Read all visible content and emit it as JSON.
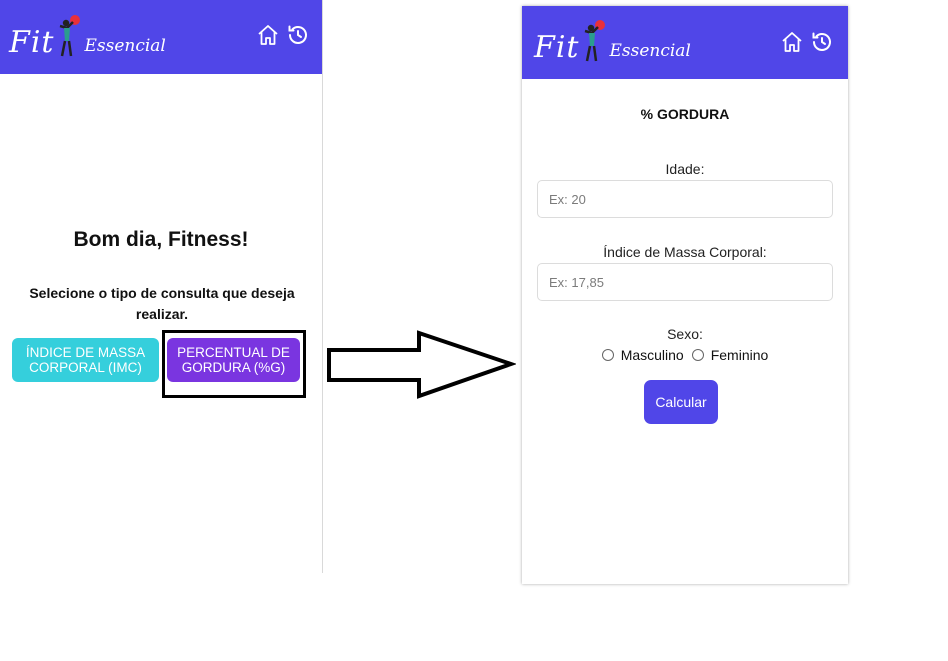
{
  "brand": {
    "logo_fit": "Fit",
    "logo_essencial": "Essencial",
    "color_primary": "#5046e8",
    "color_imc": "#35cfdc",
    "color_gordura": "#7a35e0"
  },
  "header_icons": [
    "home-icon",
    "history-icon"
  ],
  "home_screen": {
    "greeting": "Bom dia, Fitness!",
    "select_prompt": "Selecione o tipo de consulta que deseja realizar.",
    "btn_imc_line1": "ÍNDICE DE MASSA",
    "btn_imc_line2": "CORPORAL (IMC)",
    "btn_gordura_line1": "PERCENTUAL DE",
    "btn_gordura_line2": "GORDURA (%G)"
  },
  "gordura_screen": {
    "title": "% GORDURA",
    "idade_label": "Idade:",
    "idade_placeholder": "Ex: 20",
    "imc_label": "Índice de Massa Corporal:",
    "imc_placeholder": "Ex: 17,85",
    "sexo_label": "Sexo:",
    "sexo_options": [
      "Masculino",
      "Feminino"
    ],
    "calcular_label": "Calcular"
  }
}
